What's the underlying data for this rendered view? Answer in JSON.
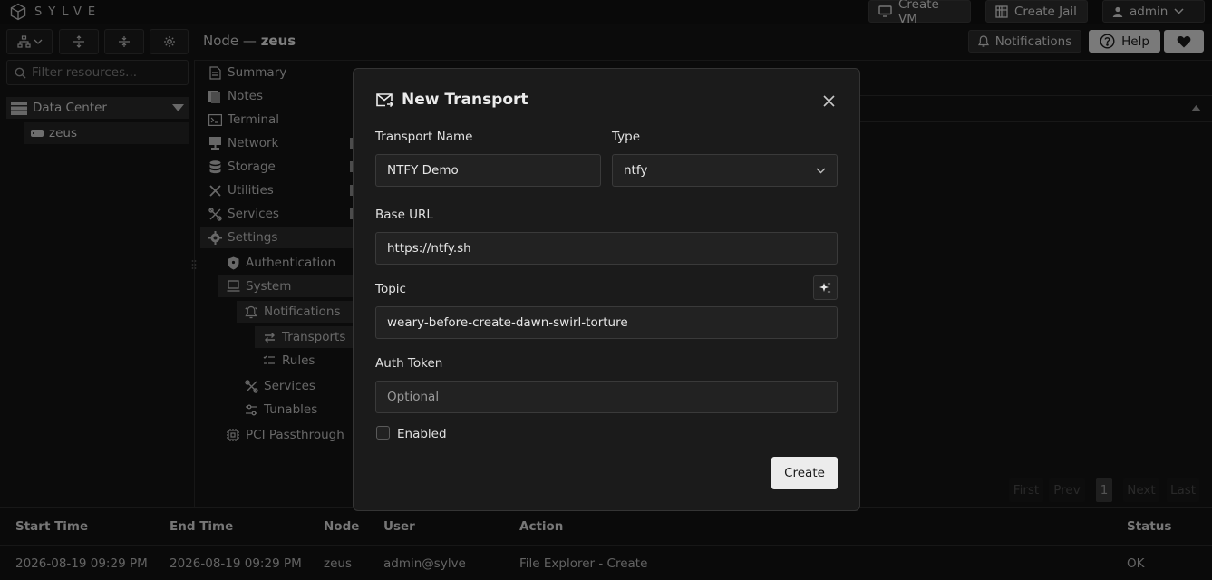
{
  "app": {
    "brand": "SYLVE"
  },
  "topbar": {
    "create_vm": "Create VM",
    "create_jail": "Create Jail",
    "user": "admin"
  },
  "search": {
    "placeholder": "Filter resources..."
  },
  "breadcrumb": {
    "prefix": "Node — ",
    "node": "zeus"
  },
  "header_actions": {
    "notifications": "Notifications",
    "help": "Help"
  },
  "tree": {
    "datacenter": "Data Center",
    "node": "zeus"
  },
  "menu": {
    "summary": "Summary",
    "notes": "Notes",
    "terminal": "Terminal",
    "network": "Network",
    "storage": "Storage",
    "utilities": "Utilities",
    "services": "Services",
    "settings": "Settings",
    "authentication": "Authentication",
    "system": "System",
    "notifications": "Notifications",
    "transports": "Transports",
    "rules": "Rules",
    "sys_services": "Services",
    "tunables": "Tunables",
    "pci": "PCI Passthrough"
  },
  "pager": {
    "first": "First",
    "prev": "Prev",
    "page": "1",
    "next": "Next",
    "last": "Last"
  },
  "audit": {
    "headers": [
      "Start Time",
      "End Time",
      "Node",
      "User",
      "Action",
      "Status"
    ],
    "row": [
      "2026-08-19 09:29 PM",
      "2026-08-19 09:29 PM",
      "zeus",
      "admin@sylve",
      "File Explorer - Create",
      "OK"
    ]
  },
  "modal": {
    "title": "New Transport",
    "name_label": "Transport Name",
    "name_value": "NTFY Demo",
    "type_label": "Type",
    "type_value": "ntfy",
    "base_url_label": "Base URL",
    "base_url_value": "https://ntfy.sh",
    "topic_label": "Topic",
    "topic_value": "weary-before-create-dawn-swirl-torture",
    "auth_label": "Auth Token",
    "auth_placeholder": "Optional",
    "enabled_label": "Enabled",
    "enabled": false,
    "create_label": "Create"
  },
  "colors": {
    "background": "#141414",
    "modal": "#1b1b1b",
    "primary_button": "#ececec"
  }
}
